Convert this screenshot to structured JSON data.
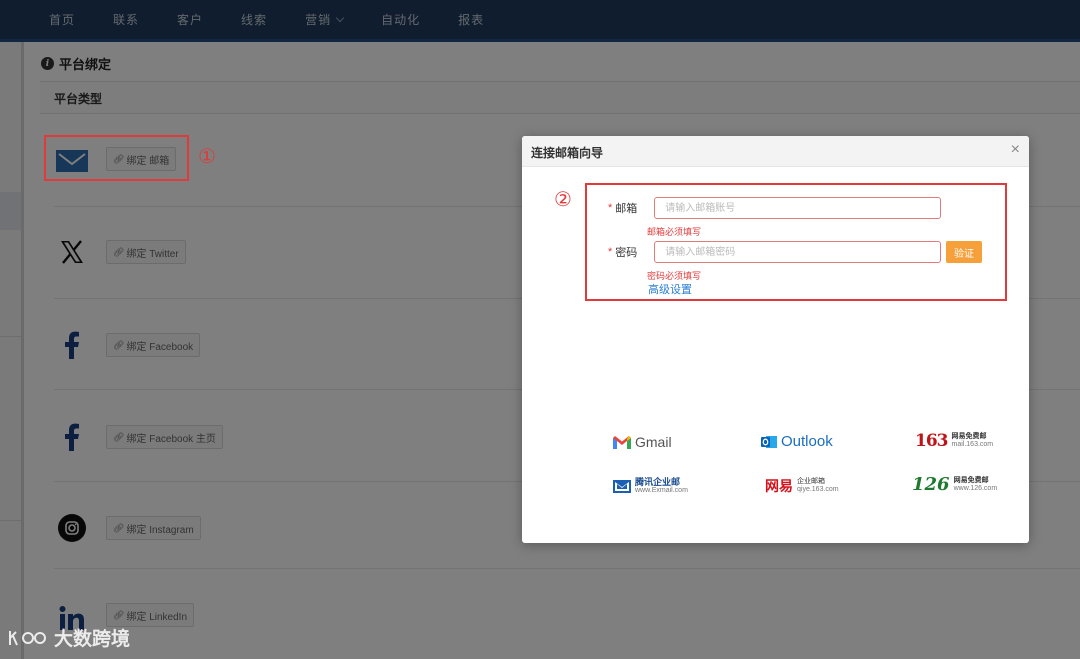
{
  "topnav": {
    "items": [
      {
        "label": "首页"
      },
      {
        "label": "联系"
      },
      {
        "label": "客户"
      },
      {
        "label": "线索"
      },
      {
        "label": "营销",
        "has_dropdown": true
      },
      {
        "label": "自动化"
      },
      {
        "label": "报表"
      }
    ]
  },
  "page": {
    "title": "平台绑定",
    "section_header": "平台类型",
    "platforms": [
      {
        "name": "email",
        "icon": "envelope-icon",
        "button": "绑定 邮箱"
      },
      {
        "name": "twitter",
        "icon": "x-logo-icon",
        "button": "绑定 Twitter"
      },
      {
        "name": "facebook",
        "icon": "facebook-icon",
        "button": "绑定 Facebook"
      },
      {
        "name": "facebook-page",
        "icon": "facebook-icon",
        "button": "绑定 Facebook 主页"
      },
      {
        "name": "instagram",
        "icon": "instagram-icon",
        "button": "绑定 Instagram"
      },
      {
        "name": "linkedin",
        "icon": "linkedin-icon",
        "button": "绑定 LinkedIn"
      }
    ]
  },
  "annotations": {
    "marker_1": "①",
    "marker_2": "②"
  },
  "modal": {
    "title": "连接邮箱向导",
    "close": "×",
    "email_label": "邮箱",
    "email_placeholder": "请输入邮箱账号",
    "email_error": "邮箱必须填写",
    "password_label": "密码",
    "password_placeholder": "请输入邮箱密码",
    "password_error": "密码必须填写",
    "required_mark": "*",
    "verify_button": "验证",
    "advanced_link": "高级设置",
    "providers": {
      "gmail": "Gmail",
      "outlook": "Outlook",
      "n163": "163",
      "n163_top": "网易免费邮",
      "n163_bottom": "mail.163.com",
      "tencent": "腾讯企业邮",
      "tencent_bottom": "www.Exmail.com",
      "netease_ent": "网易",
      "netease_ent_top": "企业邮箱",
      "netease_ent_bottom": "qiye.163.com",
      "n126": "126",
      "n126_top": "网易免费邮",
      "n126_bottom": "www.126.com"
    }
  },
  "watermark": "大数跨境",
  "colors": {
    "nav_bg": "#1e3a5c",
    "accent_red": "#e03a3a",
    "verify_orange": "#f5a03a",
    "link_blue": "#2a7ed6"
  }
}
